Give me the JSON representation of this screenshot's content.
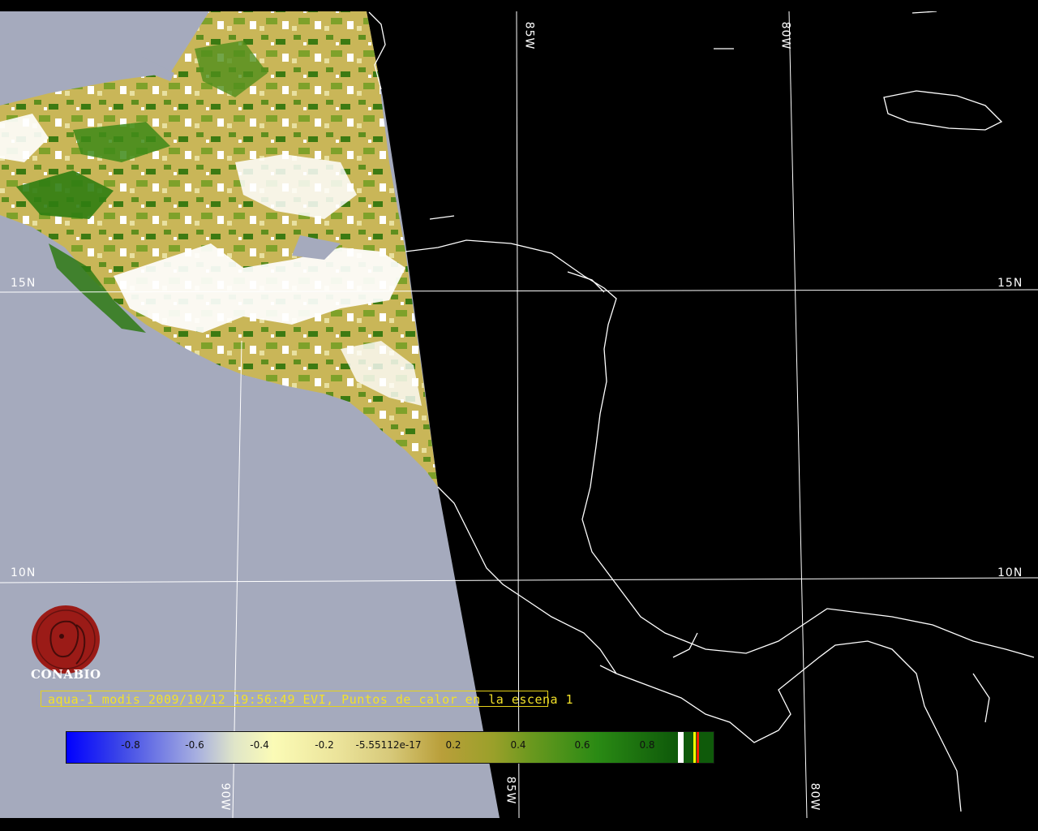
{
  "map": {
    "lat_labels": [
      "15N",
      "15N",
      "10N",
      "10N"
    ],
    "lon_labels": [
      "85W",
      "80W",
      "90W",
      "85W",
      "80W"
    ],
    "colors": {
      "ocean_visible": "#a5aabd",
      "night": "#000000",
      "coast": "#ffffff",
      "grid": "#ffffff"
    }
  },
  "logo": {
    "text": "CONABIO",
    "icon": "conabio-seal-icon",
    "color": "#9b1b17"
  },
  "caption": {
    "text": "aqua-1 modis 2009/10/12 19:56:49 EVI, Puntos de calor en la escena 1"
  },
  "colorbar": {
    "ticks": [
      "-0.8",
      "-0.6",
      "-0.4",
      "-0.2",
      "-5.55112e-17",
      "0.2",
      "0.4",
      "0.6",
      "0.8"
    ],
    "min": -1,
    "max": 1,
    "colors": [
      "#0000ff",
      "#a6aee0",
      "#fbfbb6",
      "#d7c97a",
      "#b99f3a",
      "#69981e",
      "#2a8a14",
      "#0f5a0a"
    ]
  }
}
